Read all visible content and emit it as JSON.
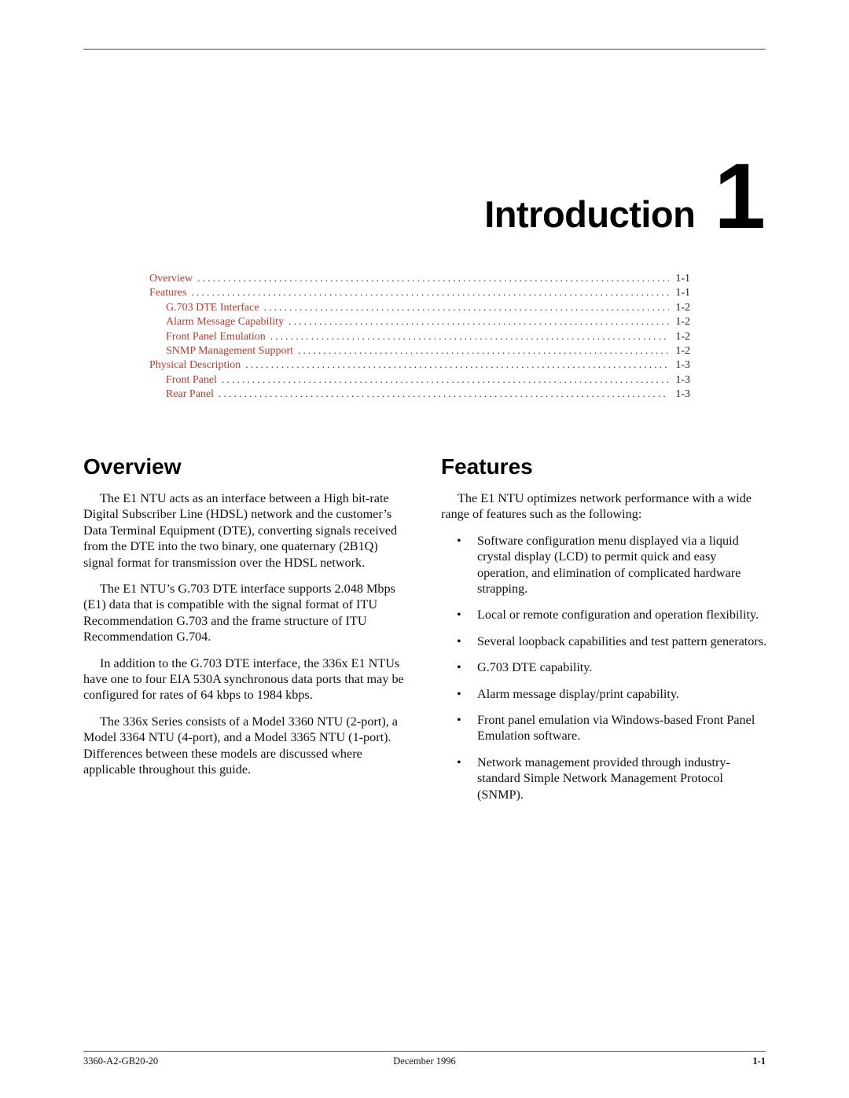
{
  "chapter": {
    "title": "Introduction",
    "number": "1"
  },
  "toc": [
    {
      "label": "Overview",
      "page": "1-1",
      "level": 1
    },
    {
      "label": "Features",
      "page": "1-1",
      "level": 1
    },
    {
      "label": "G.703 DTE Interface",
      "page": "1-2",
      "level": 2
    },
    {
      "label": "Alarm Message Capability",
      "page": "1-2",
      "level": 2
    },
    {
      "label": "Front Panel Emulation",
      "page": "1-2",
      "level": 2
    },
    {
      "label": "SNMP Management Support",
      "page": "1-2",
      "level": 2
    },
    {
      "label": "Physical Description",
      "page": "1-3",
      "level": 1
    },
    {
      "label": "Front Panel",
      "page": "1-3",
      "level": 2
    },
    {
      "label": "Rear Panel",
      "page": "1-3",
      "level": 2
    }
  ],
  "overview": {
    "heading": "Overview",
    "paragraphs": [
      "The E1 NTU acts as an interface between a High bit-rate Digital Subscriber Line (HDSL) network and the customer’s Data Terminal Equipment (DTE), converting signals received from the DTE into the two binary, one quaternary (2B1Q) signal format for transmission over the HDSL network.",
      "The E1 NTU’s G.703 DTE interface supports 2.048 Mbps (E1) data that is compatible with the signal format of ITU Recommendation G.703 and the frame structure of ITU Recommendation G.704.",
      "In addition to the G.703 DTE interface, the 336x E1 NTUs have one to four EIA 530A synchronous data ports that may be configured for rates of 64 kbps to 1984 kbps.",
      "The 336x Series consists of a Model 3360 NTU (2-port), a Model 3364 NTU (4-port), and a Model 3365 NTU (1-port). Differences between these models are discussed where applicable throughout this guide."
    ]
  },
  "features": {
    "heading": "Features",
    "intro": "The E1 NTU optimizes network performance with a wide range of features such as the following:",
    "bullet_glyph": "•",
    "items": [
      "Software configuration menu displayed via a liquid crystal display (LCD) to permit quick and easy operation, and elimination of complicated hardware strapping.",
      "Local or remote configuration and operation flexibility.",
      "Several loopback capabilities and test pattern generators.",
      "G.703 DTE capability.",
      "Alarm message display/print capability.",
      "Front panel emulation via Windows-based Front Panel Emulation software.",
      "Network management provided through industry-standard Simple Network Management Protocol (SNMP)."
    ]
  },
  "footer": {
    "doc_number": "3360-A2-GB20-20",
    "date": "December 1996",
    "page": "1-1"
  },
  "colors": {
    "toc_link": "#c0392b"
  }
}
